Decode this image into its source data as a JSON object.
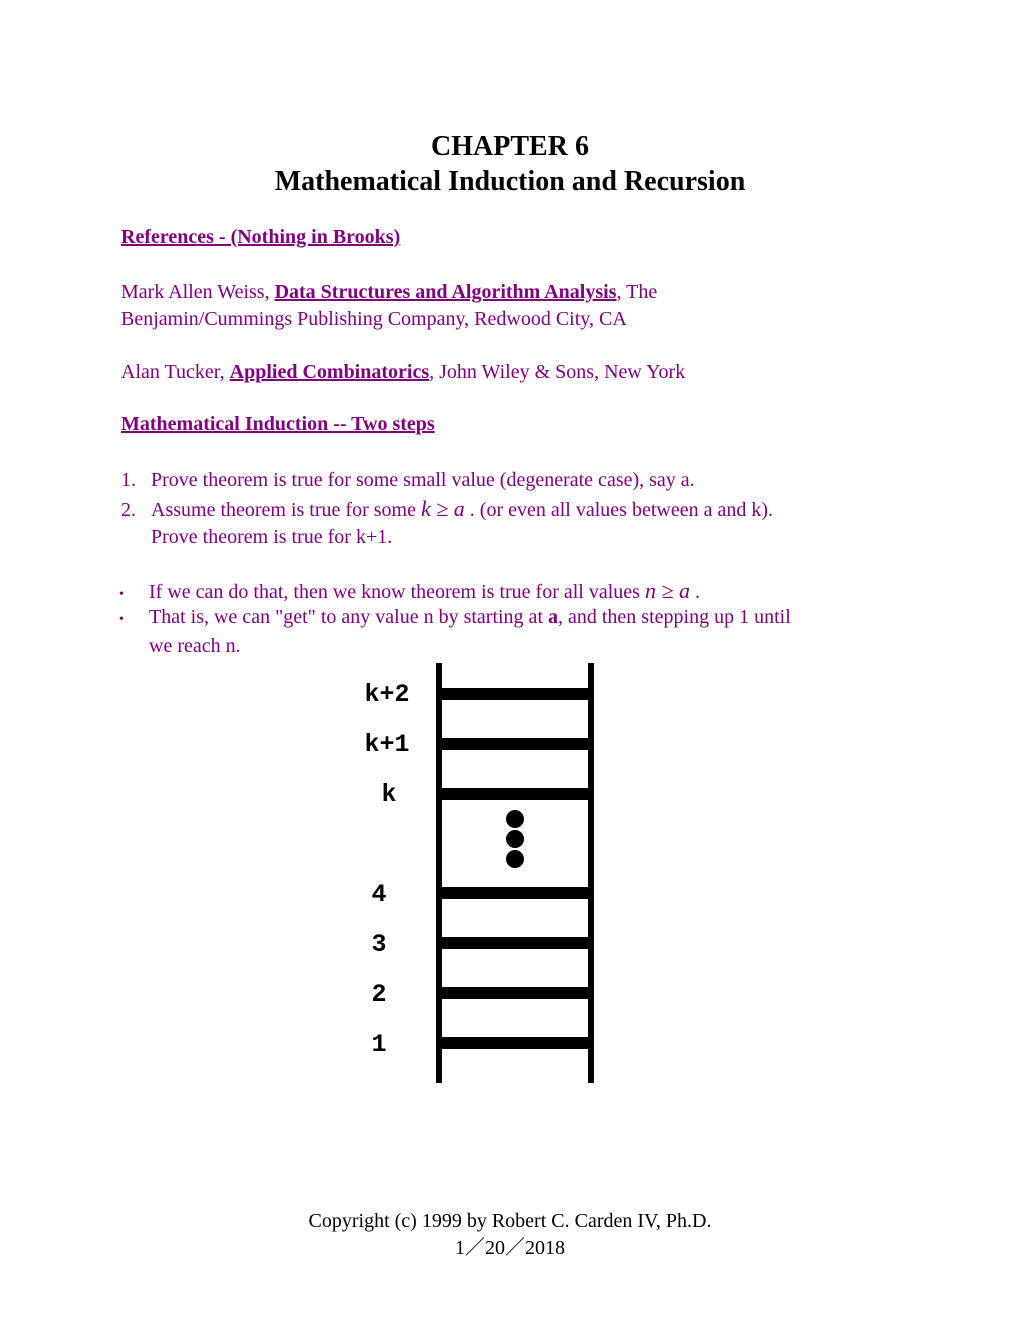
{
  "header": {
    "chapter": "CHAPTER 6",
    "title": "Mathematical Induction and Recursion"
  },
  "references": {
    "heading": "References - (Nothing in Brooks)",
    "items": [
      {
        "author": "Mark Allen Weiss, ",
        "book": "Data Structures and Algorithm Analysis",
        "rest_line1": ", The",
        "rest_line2": "Benjamin/Cummings Publishing Company, Redwood City, CA"
      },
      {
        "author": "Alan Tucker, ",
        "book": "Applied Combinatorics",
        "rest_line1": ", John Wiley & Sons, New York"
      }
    ]
  },
  "induction": {
    "heading": "Mathematical Induction -- Two steps",
    "steps": [
      {
        "number": "1.",
        "text": "Prove theorem is true for some small value (degenerate case), say a."
      },
      {
        "number": "2.",
        "text_before": "Assume theorem is true for some ",
        "math": "k ≥ a",
        "text_after": " .  (or even all values between a and k).",
        "line2": "Prove theorem is true for k+1."
      }
    ],
    "bullets": [
      {
        "text_before": "If we can do that, then we know theorem is true for all values ",
        "math": "n ≥ a",
        "text_after": " ."
      },
      {
        "text_before": "That is, we can \"get\" to any value n by starting at ",
        "bold": "a",
        "text_after": ", and then stepping up 1 until",
        "line2": "we reach n."
      }
    ],
    "bullet_glyph": "•"
  },
  "ladder": {
    "labels": [
      "k+2",
      "k+1",
      "k",
      "4",
      "3",
      "2",
      "1"
    ]
  },
  "footer": {
    "copyright": "Copyright (c) 1999 by  Robert C. Carden IV, Ph.D.",
    "date": "1／20／2018"
  }
}
